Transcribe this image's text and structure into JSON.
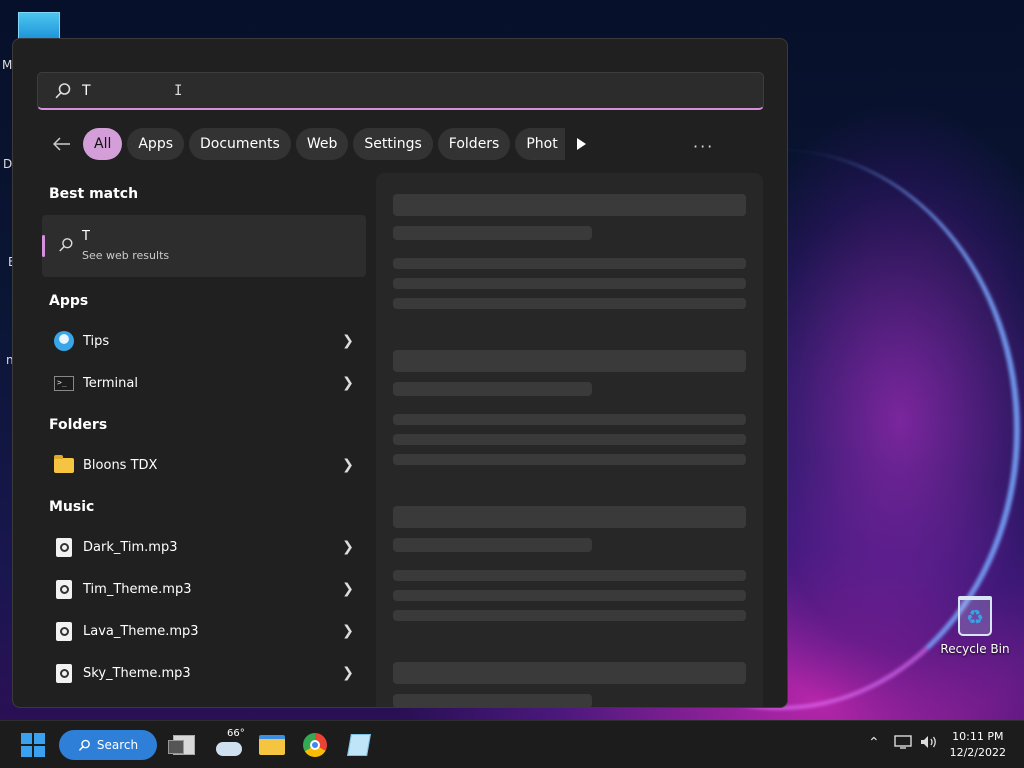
{
  "search": {
    "query": "T"
  },
  "filters": [
    "All",
    "Apps",
    "Documents",
    "Web",
    "Settings",
    "Folders",
    "Phot"
  ],
  "more_label": "···",
  "best_match": {
    "title": "Best match",
    "label": "T",
    "sublabel": "See web results"
  },
  "sections": {
    "apps": "Apps",
    "folders": "Folders",
    "music": "Music"
  },
  "apps": [
    {
      "label": "Tips",
      "icon": "tips-icon"
    },
    {
      "label": "Terminal",
      "icon": "terminal-icon"
    }
  ],
  "folders": [
    {
      "label": "Bloons TDX",
      "icon": "folder-icon"
    }
  ],
  "music": [
    {
      "label": "Dark_Tim.mp3"
    },
    {
      "label": "Tim_Theme.mp3"
    },
    {
      "label": "Lava_Theme.mp3"
    },
    {
      "label": "Sky_Theme.mp3"
    }
  ],
  "desktop": {
    "recycle_bin": "Recycle Bin",
    "edge_letters": [
      "M",
      "Da",
      "E",
      "n"
    ]
  },
  "taskbar": {
    "search_label": "Search",
    "weather_temp": "66°",
    "time": "10:11 PM",
    "date": "12/2/2022"
  },
  "colors": {
    "accent": "#d68fdc",
    "panel_bg": "#202020",
    "taskbar_search": "#2d7fd8"
  }
}
